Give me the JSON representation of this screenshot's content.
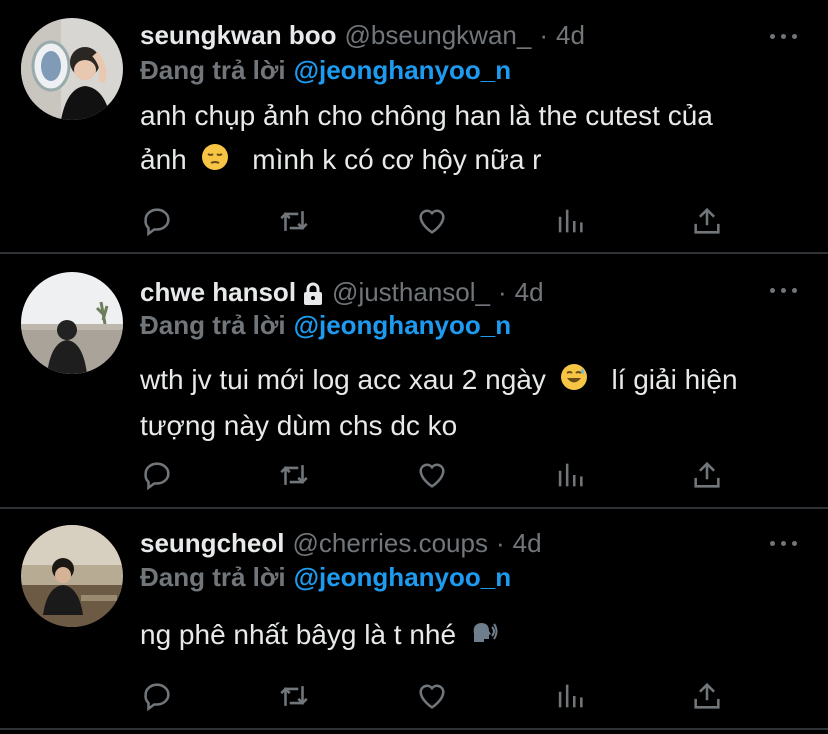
{
  "replies": [
    {
      "display_name": "seungkwan boo",
      "handle": "@bseungkwan_",
      "separator": "·",
      "time": "4d",
      "replying_label": "Đang trả lời",
      "replying_to": "@jeonghanyoo_n",
      "text_line1": "anh chụp ảnh cho chông han là the cutest của",
      "text_line2_a": "ảnh",
      "text_line2_b": "mình k có cơ hộy nữa r",
      "emoji": "pensive-face",
      "locked": false
    },
    {
      "display_name": "chwe hansol",
      "handle": "@justhansol_",
      "separator": "·",
      "time": "4d",
      "replying_label": "Đang trả lời",
      "replying_to": "@jeonghanyoo_n",
      "text_line1_a": "wth jv tui mới log acc xau 2 ngày",
      "text_line1_b": "lí giải hiện",
      "text_line2": "tượng này dùm chs dc ko",
      "emoji": "grinning-sweat-face",
      "locked": true
    },
    {
      "display_name": "seungcheol",
      "handle": "@cherries.coups",
      "separator": "·",
      "time": "4d",
      "replying_label": "Đang trả lời",
      "replying_to": "@jeonghanyoo_n",
      "text_line1": "ng phê nhất bâyg là t nhé",
      "emoji": "speaking-head",
      "locked": false
    }
  ],
  "colors": {
    "background": "#000000",
    "text": "#e7e9ea",
    "muted": "#71767b",
    "accent": "#1d9bf0",
    "divider": "#2f3336"
  },
  "action_icons": [
    "reply-icon",
    "retweet-icon",
    "like-icon",
    "views-icon",
    "share-icon"
  ]
}
